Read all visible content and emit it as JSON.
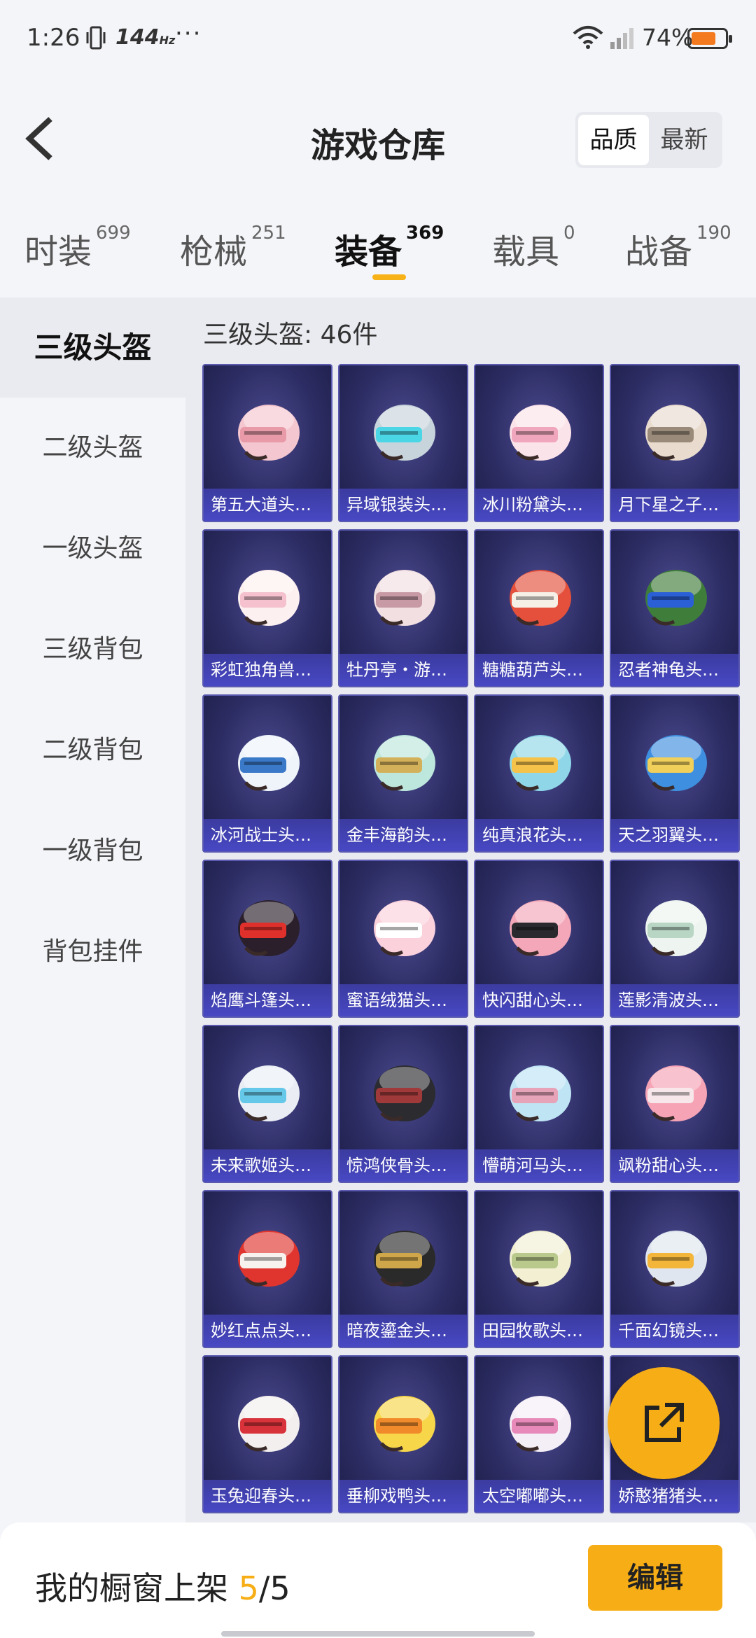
{
  "status_bar": {
    "time": "1:26",
    "refresh_rate": "144",
    "refresh_unit": "Hz",
    "more": "···",
    "battery_percent": "74%",
    "battery_level": 0.74,
    "battery_color": "#f47a1f"
  },
  "header": {
    "title": "游戏仓库",
    "sort_options": [
      "品质",
      "最新"
    ],
    "sort_selected": "品质"
  },
  "tabs": [
    {
      "label": "时装",
      "count": "699"
    },
    {
      "label": "枪械",
      "count": "251"
    },
    {
      "label": "装备",
      "count": "369",
      "active": true
    },
    {
      "label": "载具",
      "count": "0"
    },
    {
      "label": "战备",
      "count": "190"
    }
  ],
  "sidebar": {
    "items": [
      "三级头盔",
      "二级头盔",
      "一级头盔",
      "三级背包",
      "二级背包",
      "一级背包",
      "背包挂件"
    ],
    "active": "三级头盔"
  },
  "main": {
    "section_title": "三级头盔: 46件",
    "items": [
      {
        "name": "第五大道头盔...",
        "c1": "#f4c6cf",
        "c2": "#e89aa9"
      },
      {
        "name": "异域银装头盔...",
        "c1": "#c8d4dc",
        "c2": "#4bd6e6"
      },
      {
        "name": "冰川粉黛头盔...",
        "c1": "#fbe3ea",
        "c2": "#f0a7bd"
      },
      {
        "name": "月下星之子头...",
        "c1": "#e9dccf",
        "c2": "#9a8a7a"
      },
      {
        "name": "彩虹独角兽头...",
        "c1": "#fdf0f0",
        "c2": "#f5c1cf"
      },
      {
        "name": "牡丹亭・游园...",
        "c1": "#f1dfe2",
        "c2": "#c89aa6"
      },
      {
        "name": "糖糖葫芦头盔...",
        "c1": "#e4503b",
        "c2": "#f5efe6"
      },
      {
        "name": "忍者神龟头盔...",
        "c1": "#3f7d3a",
        "c2": "#2b5fd6"
      },
      {
        "name": "冰河战士头盔...",
        "c1": "#eef4fa",
        "c2": "#3a78c8"
      },
      {
        "name": "金丰海韵头盔...",
        "c1": "#bde6dc",
        "c2": "#d3b15a"
      },
      {
        "name": "纯真浪花头盔...",
        "c1": "#8fd7e8",
        "c2": "#f6c34a"
      },
      {
        "name": "天之羽翼头盔...",
        "c1": "#3f8fe0",
        "c2": "#f0cf5a"
      },
      {
        "name": "焰鹰斗篷头盔...",
        "c1": "#2a1f2a",
        "c2": "#e0302c"
      },
      {
        "name": "蜜语绒猫头盔...",
        "c1": "#fbd1dc",
        "c2": "#ffffff"
      },
      {
        "name": "快闪甜心头盔...",
        "c1": "#f3a7b8",
        "c2": "#2a2a2e"
      },
      {
        "name": "莲影清波头盔...",
        "c1": "#eef4ef",
        "c2": "#b9d6c5"
      },
      {
        "name": "未来歌姬头盔...",
        "c1": "#eaeef4",
        "c2": "#66c8e8"
      },
      {
        "name": "惊鸿侠骨头盔...",
        "c1": "#2b2b30",
        "c2": "#a03a3a"
      },
      {
        "name": "懵萌河马头盔...",
        "c1": "#bfe4f4",
        "c2": "#e7a3b8"
      },
      {
        "name": "飒粉甜心头盔...",
        "c1": "#f5a3b5",
        "c2": "#f7e6ea"
      },
      {
        "name": "妙红点点头盔...",
        "c1": "#e0352e",
        "c2": "#f7f2ee"
      },
      {
        "name": "暗夜鎏金头盔...",
        "c1": "#2b2a2a",
        "c2": "#cfa64a"
      },
      {
        "name": "田园牧歌头盔...",
        "c1": "#f2efd3",
        "c2": "#b9c98b"
      },
      {
        "name": "千面幻镜头盔...",
        "c1": "#dfe6ef",
        "c2": "#f3b53a"
      },
      {
        "name": "玉兔迎春头盔...",
        "c1": "#f3efee",
        "c2": "#d8323a"
      },
      {
        "name": "垂柳戏鸭头盔...",
        "c1": "#f7d64a",
        "c2": "#f08a2a"
      },
      {
        "name": "太空嘟嘟头盔...",
        "c1": "#f4eef6",
        "c2": "#e78ab9"
      },
      {
        "name": "娇憨猪猪头盔...",
        "c1": "#f5b8c8",
        "c2": "#ffffff"
      }
    ]
  },
  "fab": {
    "icon": "share-icon"
  },
  "bottom_bar": {
    "label": "我的橱窗上架",
    "current": "5",
    "separator": "/",
    "total": "5",
    "edit_label": "编辑"
  }
}
